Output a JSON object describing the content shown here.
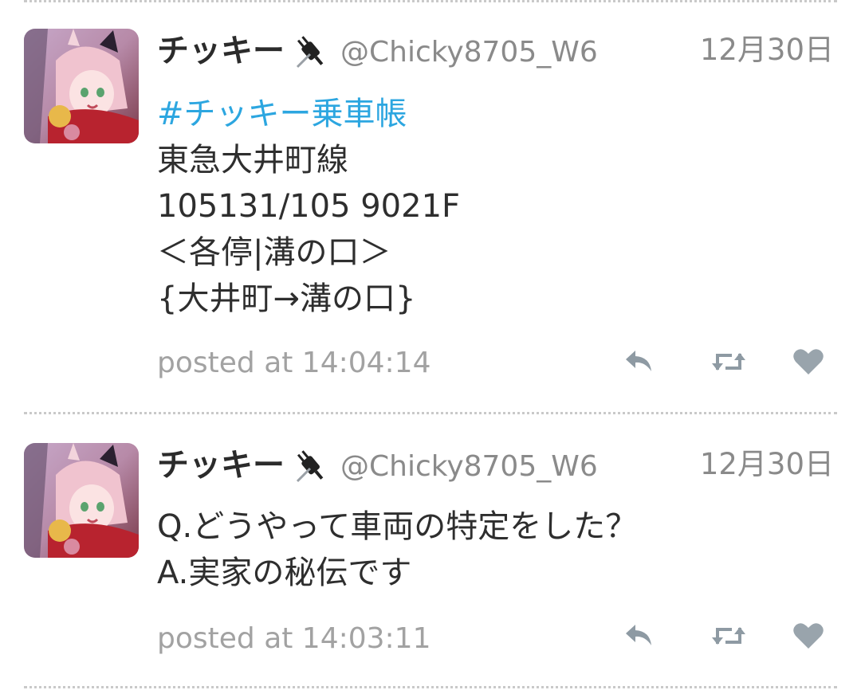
{
  "colors": {
    "hashtag": "#2ca6e0",
    "name": "#2b2b2b",
    "meta": "#8a8a8a",
    "action_icon": "#8e9aa3"
  },
  "tweets": [
    {
      "display_name": "チッキー",
      "screen_name": "@Chicky8705_W6",
      "date": "12月30日",
      "hashtag": "#チッキー乗車帳",
      "lines": [
        "東急大井町線",
        "105131/105 9021F",
        "＜各停|溝の口＞",
        "{大井町→溝の口}"
      ],
      "posted_at": "posted at 14:04:14",
      "icons": [
        "plug-icon",
        "reply-icon",
        "retweet-icon",
        "heart-icon"
      ]
    },
    {
      "display_name": "チッキー",
      "screen_name": "@Chicky8705_W6",
      "date": "12月30日",
      "lines": [
        "Q.どうやって車両の特定をした？",
        "A.実家の秘伝です"
      ],
      "posted_at": "posted at 14:03:11",
      "icons": [
        "plug-icon",
        "reply-icon",
        "retweet-icon",
        "heart-icon"
      ]
    }
  ]
}
